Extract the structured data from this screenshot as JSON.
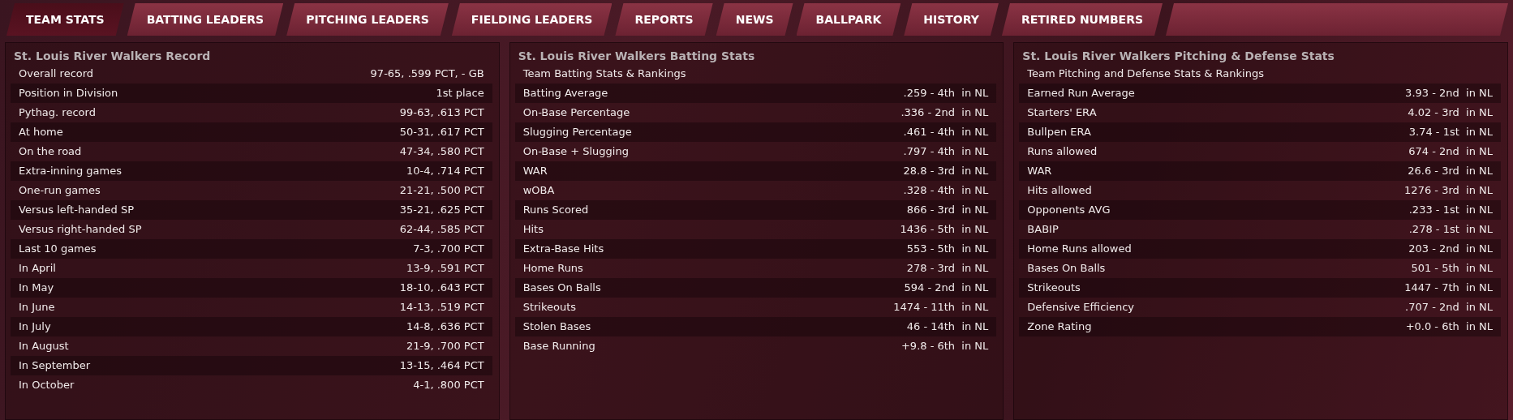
{
  "tabs": [
    {
      "label": "TEAM STATS",
      "selected": true
    },
    {
      "label": "BATTING LEADERS",
      "selected": false
    },
    {
      "label": "PITCHING LEADERS",
      "selected": false
    },
    {
      "label": "FIELDING LEADERS",
      "selected": false
    },
    {
      "label": "REPORTS",
      "selected": false
    },
    {
      "label": "NEWS",
      "selected": false
    },
    {
      "label": "BALLPARK",
      "selected": false
    },
    {
      "label": "HISTORY",
      "selected": false
    },
    {
      "label": "RETIRED NUMBERS",
      "selected": false
    }
  ],
  "panels": [
    {
      "title": "St. Louis River Walkers Record",
      "rows": [
        {
          "label": "Overall record",
          "value": "97-65, .599 PCT, - GB"
        },
        {
          "label": "Position in Division",
          "value": "1st place"
        },
        {
          "label": "Pythag. record",
          "value": "99-63, .613 PCT"
        },
        {
          "label": "At home",
          "value": "50-31, .617 PCT"
        },
        {
          "label": "On the road",
          "value": "47-34, .580 PCT"
        },
        {
          "label": "Extra-inning games",
          "value": "10-4, .714 PCT"
        },
        {
          "label": "One-run games",
          "value": "21-21, .500 PCT"
        },
        {
          "label": "Versus left-handed SP",
          "value": "35-21, .625 PCT"
        },
        {
          "label": "Versus right-handed SP",
          "value": "62-44, .585 PCT"
        },
        {
          "label": "Last 10 games",
          "value": "7-3, .700 PCT"
        },
        {
          "label": "In April",
          "value": "13-9, .591 PCT"
        },
        {
          "label": "In May",
          "value": "18-10, .643 PCT"
        },
        {
          "label": "In June",
          "value": "14-13, .519 PCT"
        },
        {
          "label": "In July",
          "value": "14-8, .636 PCT"
        },
        {
          "label": "In August",
          "value": "21-9, .700 PCT"
        },
        {
          "label": "In September",
          "value": "13-15, .464 PCT"
        },
        {
          "label": "In October",
          "value": "4-1, .800 PCT"
        }
      ]
    },
    {
      "title": "St. Louis River Walkers Batting Stats",
      "subtitle": "Team Batting Stats & Rankings",
      "rows": [
        {
          "label": "Batting Average",
          "value": ".259 - 4th  in NL"
        },
        {
          "label": "On-Base Percentage",
          "value": ".336 - 2nd  in NL"
        },
        {
          "label": "Slugging Percentage",
          "value": ".461 - 4th  in NL"
        },
        {
          "label": "On-Base + Slugging",
          "value": ".797 - 4th  in NL"
        },
        {
          "label": "WAR",
          "value": "28.8 - 3rd  in NL"
        },
        {
          "label": "wOBA",
          "value": ".328 - 4th  in NL"
        },
        {
          "label": "Runs Scored",
          "value": "866 - 3rd  in NL"
        },
        {
          "label": "Hits",
          "value": "1436 - 5th  in NL"
        },
        {
          "label": "Extra-Base Hits",
          "value": "553 - 5th  in NL"
        },
        {
          "label": "Home Runs",
          "value": "278 - 3rd  in NL"
        },
        {
          "label": "Bases On Balls",
          "value": "594 - 2nd  in NL"
        },
        {
          "label": "Strikeouts",
          "value": "1474 - 11th  in NL"
        },
        {
          "label": "Stolen Bases",
          "value": "46 - 14th  in NL"
        },
        {
          "label": "Base Running",
          "value": "+9.8 - 6th  in NL"
        }
      ]
    },
    {
      "title": "St. Louis River Walkers Pitching & Defense Stats",
      "subtitle": "Team Pitching and Defense Stats & Rankings",
      "rows": [
        {
          "label": "Earned Run Average",
          "value": "3.93 - 2nd  in NL"
        },
        {
          "label": "Starters' ERA",
          "value": "4.02 - 3rd  in NL"
        },
        {
          "label": "Bullpen ERA",
          "value": "3.74 - 1st  in NL"
        },
        {
          "label": "Runs allowed",
          "value": "674 - 2nd  in NL"
        },
        {
          "label": "WAR",
          "value": "26.6 - 3rd  in NL"
        },
        {
          "label": "Hits allowed",
          "value": "1276 - 3rd  in NL"
        },
        {
          "label": "Opponents AVG",
          "value": ".233 - 1st  in NL"
        },
        {
          "label": "BABIP",
          "value": ".278 - 1st  in NL"
        },
        {
          "label": "Home Runs allowed",
          "value": "203 - 2nd  in NL"
        },
        {
          "label": "Bases On Balls",
          "value": "501 - 5th  in NL"
        },
        {
          "label": "Strikeouts",
          "value": "1447 - 7th  in NL"
        },
        {
          "label": "Defensive Efficiency",
          "value": ".707 - 2nd  in NL"
        },
        {
          "label": "Zone Rating",
          "value": "+0.0 - 6th  in NL"
        }
      ]
    }
  ]
}
